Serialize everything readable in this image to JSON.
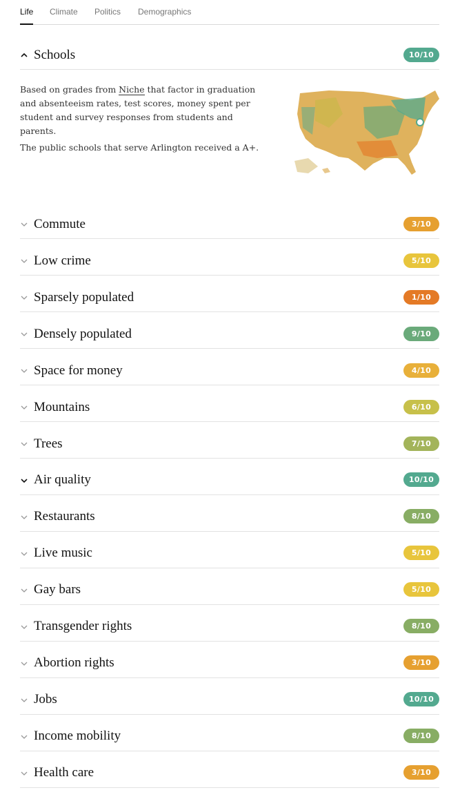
{
  "tabs": [
    "Life",
    "Climate",
    "Politics",
    "Demographics"
  ],
  "active_tab": "Life",
  "schools": {
    "label": "Schools",
    "score": "10/10",
    "color": "#53a98f",
    "expanded": true,
    "description_before_link": "Based on grades from ",
    "description_link": "Niche",
    "description_after_link": " that factor in graduation and absenteeism rates, test scores, money spent per student and survey responses from students and parents.",
    "result": "The public schools that serve Arlington received a A+."
  },
  "items": [
    {
      "label": "Commute",
      "score": "3/10",
      "color": "#e6a030"
    },
    {
      "label": "Low crime",
      "score": "5/10",
      "color": "#e8c53c"
    },
    {
      "label": "Sparsely populated",
      "score": "1/10",
      "color": "#e47a26"
    },
    {
      "label": "Densely populated",
      "score": "9/10",
      "color": "#6aaa7a"
    },
    {
      "label": "Space for money",
      "score": "4/10",
      "color": "#e8b03a"
    },
    {
      "label": "Mountains",
      "score": "6/10",
      "color": "#c7c04a"
    },
    {
      "label": "Trees",
      "score": "7/10",
      "color": "#a3b45a"
    },
    {
      "label": "Air quality",
      "score": "10/10",
      "color": "#53a98f"
    },
    {
      "label": "Restaurants",
      "score": "8/10",
      "color": "#88ad64"
    },
    {
      "label": "Live music",
      "score": "5/10",
      "color": "#e8c53c"
    },
    {
      "label": "Gay bars",
      "score": "5/10",
      "color": "#e8c53c"
    },
    {
      "label": "Transgender rights",
      "score": "8/10",
      "color": "#88ad64"
    },
    {
      "label": "Abortion rights",
      "score": "3/10",
      "color": "#e6a030"
    },
    {
      "label": "Jobs",
      "score": "10/10",
      "color": "#53a98f"
    },
    {
      "label": "Income mobility",
      "score": "8/10",
      "color": "#88ad64"
    },
    {
      "label": "Health care",
      "score": "3/10",
      "color": "#e6a030"
    }
  ],
  "icons": {
    "collapsed": "chevron-down-icon",
    "expanded": "chevron-up-icon"
  },
  "map_icon": "us-map-icon",
  "accent_text": "#121212",
  "muted_text": "#777777"
}
